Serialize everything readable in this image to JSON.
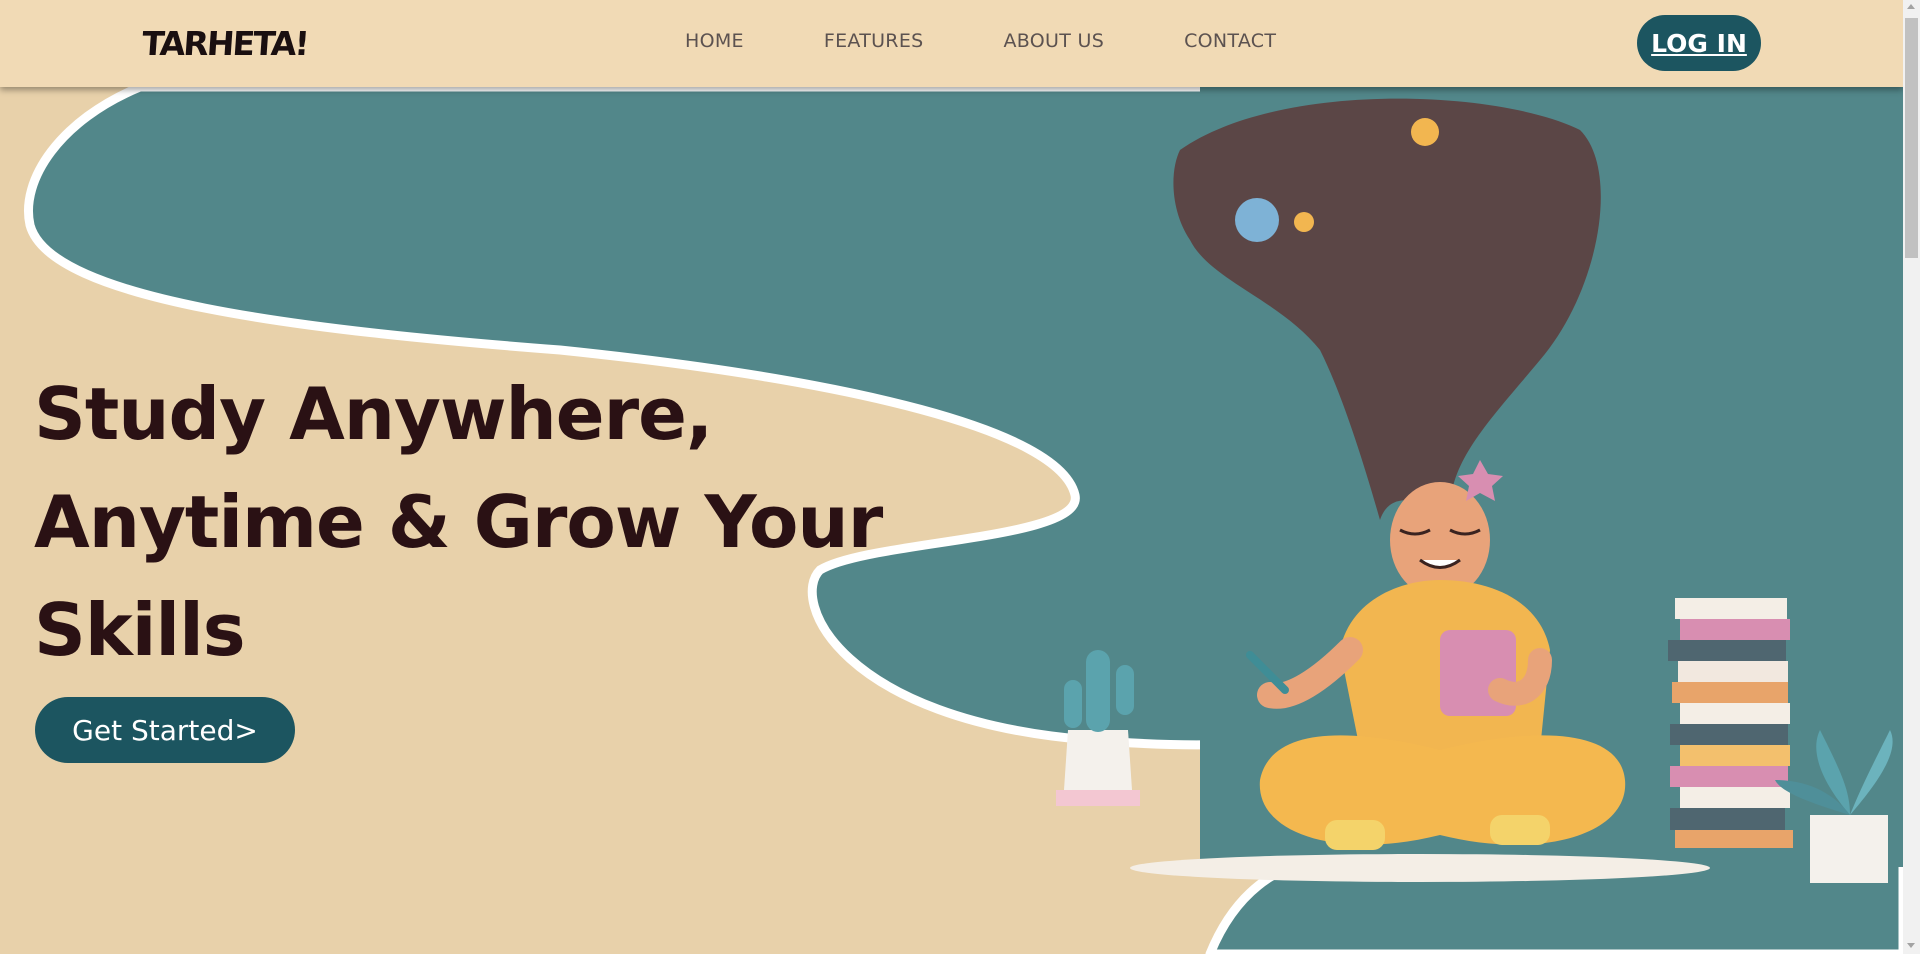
{
  "nav": {
    "logo": "TARHETA!",
    "links": [
      "HOME",
      "FEATURES",
      "ABOUT US",
      "CONTACT"
    ],
    "login": "LOG IN"
  },
  "hero": {
    "headline_lines": [
      "Study Anywhere,",
      "Anytime & Grow Your",
      "Skills"
    ],
    "cta": "Get Started>"
  },
  "colors": {
    "nav_bg": "#f1dab5",
    "page_bg": "#e8d1aa",
    "teal_shape": "#52878a",
    "button": "#1c5560",
    "headline": "#2a1114"
  },
  "icons": {
    "illustration": "student-meditating-with-tablet-illustration"
  }
}
